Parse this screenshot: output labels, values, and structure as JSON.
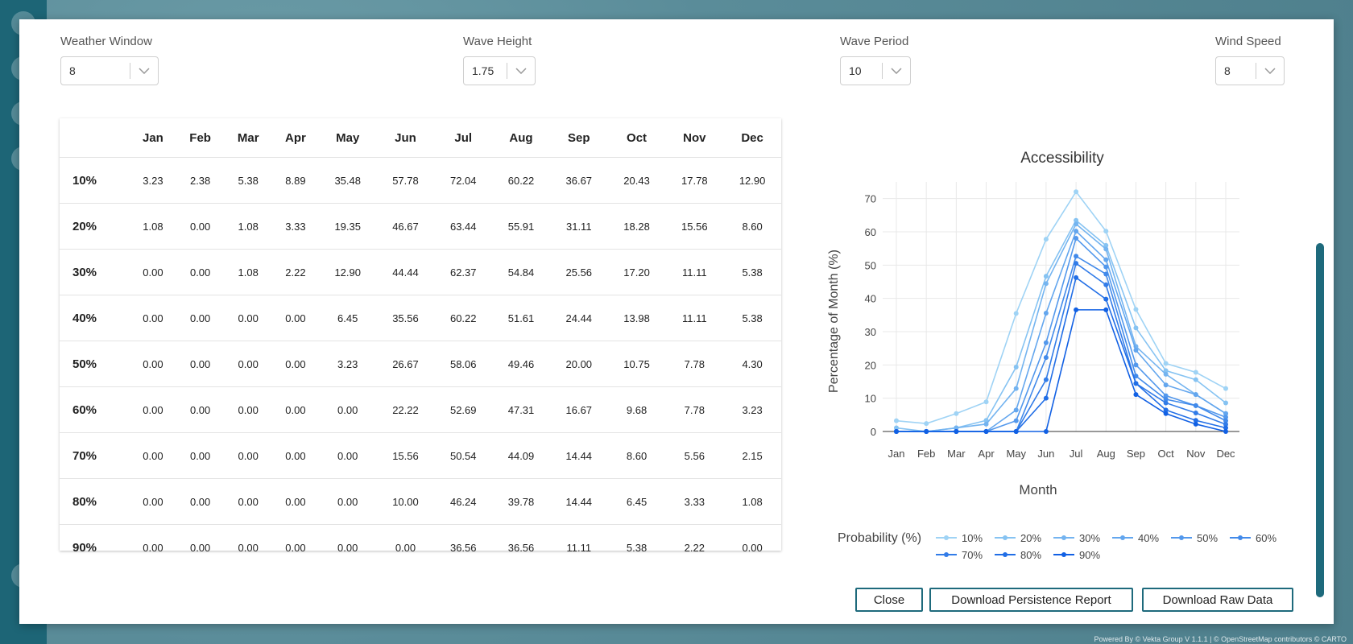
{
  "background": {
    "attribution": "Powered By © Vekta Group V 1.1.1 | © OpenStreetMap contributors © CARTO"
  },
  "filters": [
    {
      "label": "Weather Window",
      "value": "8"
    },
    {
      "label": "Wave Height",
      "value": "1.75"
    },
    {
      "label": "Wave Period",
      "value": "10"
    },
    {
      "label": "Wind Speed",
      "value": "8"
    }
  ],
  "table": {
    "columns": [
      "Jan",
      "Feb",
      "Mar",
      "Apr",
      "May",
      "Jun",
      "Jul",
      "Aug",
      "Sep",
      "Oct",
      "Nov",
      "Dec"
    ],
    "rows": [
      {
        "label": "10%",
        "values": [
          "3.23",
          "2.38",
          "5.38",
          "8.89",
          "35.48",
          "57.78",
          "72.04",
          "60.22",
          "36.67",
          "20.43",
          "17.78",
          "12.90"
        ]
      },
      {
        "label": "20%",
        "values": [
          "1.08",
          "0.00",
          "1.08",
          "3.33",
          "19.35",
          "46.67",
          "63.44",
          "55.91",
          "31.11",
          "18.28",
          "15.56",
          "8.60"
        ]
      },
      {
        "label": "30%",
        "values": [
          "0.00",
          "0.00",
          "1.08",
          "2.22",
          "12.90",
          "44.44",
          "62.37",
          "54.84",
          "25.56",
          "17.20",
          "11.11",
          "5.38"
        ]
      },
      {
        "label": "40%",
        "values": [
          "0.00",
          "0.00",
          "0.00",
          "0.00",
          "6.45",
          "35.56",
          "60.22",
          "51.61",
          "24.44",
          "13.98",
          "11.11",
          "5.38"
        ]
      },
      {
        "label": "50%",
        "values": [
          "0.00",
          "0.00",
          "0.00",
          "0.00",
          "3.23",
          "26.67",
          "58.06",
          "49.46",
          "20.00",
          "10.75",
          "7.78",
          "4.30"
        ]
      },
      {
        "label": "60%",
        "values": [
          "0.00",
          "0.00",
          "0.00",
          "0.00",
          "0.00",
          "22.22",
          "52.69",
          "47.31",
          "16.67",
          "9.68",
          "7.78",
          "3.23"
        ]
      },
      {
        "label": "70%",
        "values": [
          "0.00",
          "0.00",
          "0.00",
          "0.00",
          "0.00",
          "15.56",
          "50.54",
          "44.09",
          "14.44",
          "8.60",
          "5.56",
          "2.15"
        ]
      },
      {
        "label": "80%",
        "values": [
          "0.00",
          "0.00",
          "0.00",
          "0.00",
          "0.00",
          "10.00",
          "46.24",
          "39.78",
          "14.44",
          "6.45",
          "3.33",
          "1.08"
        ]
      },
      {
        "label": "90%",
        "values": [
          "0.00",
          "0.00",
          "0.00",
          "0.00",
          "0.00",
          "0.00",
          "36.56",
          "36.56",
          "11.11",
          "5.38",
          "2.22",
          "0.00"
        ]
      }
    ]
  },
  "chart_data": {
    "type": "line",
    "title": "Accessibility",
    "xlabel": "Month",
    "ylabel": "Percentage of Month (%)",
    "x": [
      "Jan",
      "Feb",
      "Mar",
      "Apr",
      "May",
      "Jun",
      "Jul",
      "Aug",
      "Sep",
      "Oct",
      "Nov",
      "Dec"
    ],
    "yticks": [
      0,
      10,
      20,
      30,
      40,
      50,
      60,
      70
    ],
    "ylim": [
      0,
      75
    ],
    "grid": true,
    "legend_title": "Probability (%)",
    "legend_position": "bottom",
    "series": [
      {
        "name": "10%",
        "color": "#9fd3f5",
        "values": [
          3.23,
          2.38,
          5.38,
          8.89,
          35.48,
          57.78,
          72.04,
          60.22,
          36.67,
          20.43,
          17.78,
          12.9
        ]
      },
      {
        "name": "20%",
        "color": "#86c3f2",
        "values": [
          1.08,
          0,
          1.08,
          3.33,
          19.35,
          46.67,
          63.44,
          55.91,
          31.11,
          18.28,
          15.56,
          8.6
        ]
      },
      {
        "name": "30%",
        "color": "#74b4f0",
        "values": [
          0,
          0,
          1.08,
          2.22,
          12.9,
          44.44,
          62.37,
          54.84,
          25.56,
          17.2,
          11.11,
          5.38
        ]
      },
      {
        "name": "40%",
        "color": "#63a6ee",
        "values": [
          0,
          0,
          0,
          0,
          6.45,
          35.56,
          60.22,
          51.61,
          24.44,
          13.98,
          11.11,
          5.38
        ]
      },
      {
        "name": "50%",
        "color": "#5398ec",
        "values": [
          0,
          0,
          0,
          0,
          3.23,
          26.67,
          58.06,
          49.46,
          20.0,
          10.75,
          7.78,
          4.3
        ]
      },
      {
        "name": "60%",
        "color": "#428aea",
        "values": [
          0,
          0,
          0,
          0,
          0,
          22.22,
          52.69,
          47.31,
          16.67,
          9.68,
          7.78,
          3.23
        ]
      },
      {
        "name": "70%",
        "color": "#327ce8",
        "values": [
          0,
          0,
          0,
          0,
          0,
          15.56,
          50.54,
          44.09,
          14.44,
          8.6,
          5.56,
          2.15
        ]
      },
      {
        "name": "80%",
        "color": "#216ee6",
        "values": [
          0,
          0,
          0,
          0,
          0,
          10.0,
          46.24,
          39.78,
          14.44,
          6.45,
          3.33,
          1.08
        ]
      },
      {
        "name": "90%",
        "color": "#1160e4",
        "values": [
          0,
          0,
          0,
          0,
          0,
          0,
          36.56,
          36.56,
          11.11,
          5.38,
          2.22,
          0
        ]
      }
    ]
  },
  "buttons": {
    "close": "Close",
    "download_report": "Download Persistence Report",
    "download_raw": "Download Raw Data"
  }
}
